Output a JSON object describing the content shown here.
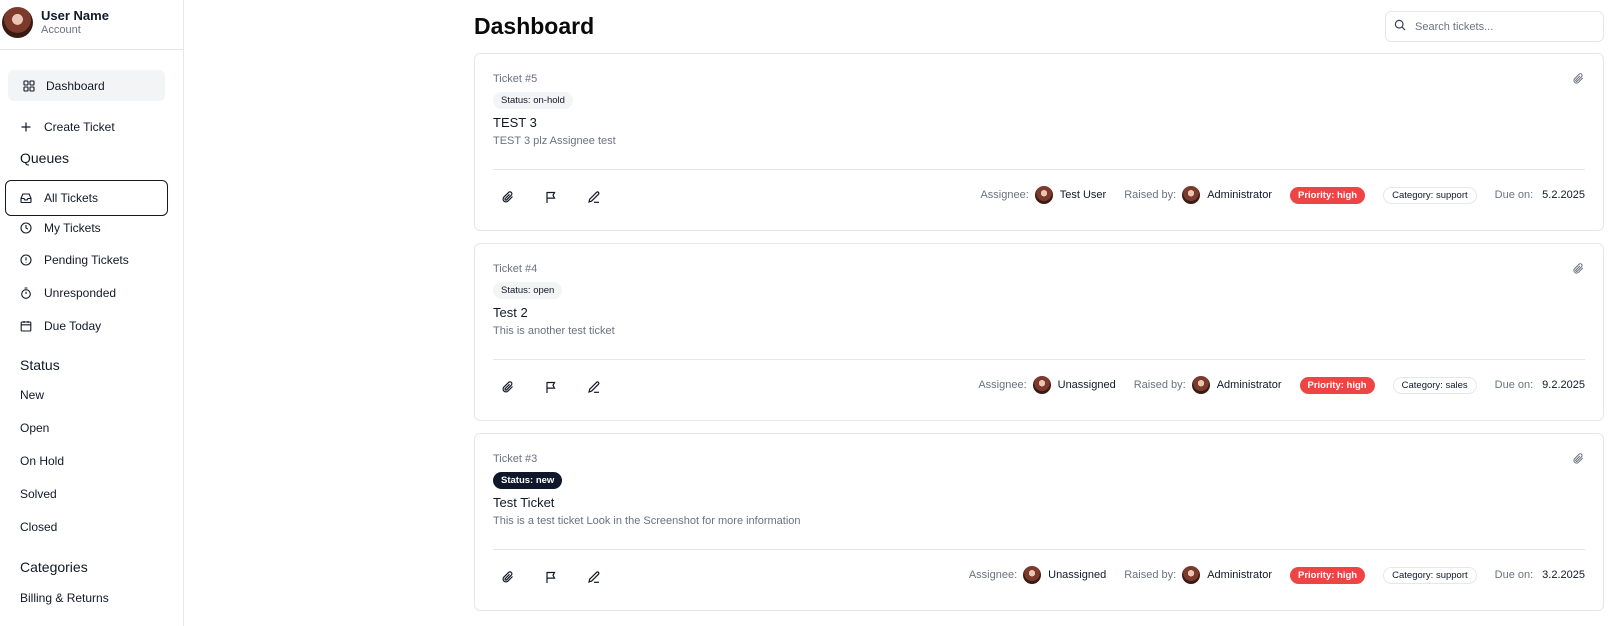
{
  "user": {
    "name": "User Name",
    "sub": "Account"
  },
  "nav": {
    "dashboard": "Dashboard",
    "create_ticket": "Create Ticket"
  },
  "queues": {
    "heading": "Queues",
    "items": [
      "All Tickets",
      "My Tickets",
      "Pending Tickets",
      "Unresponded",
      "Due Today"
    ]
  },
  "status_section": {
    "heading": "Status",
    "items": [
      "New",
      "Open",
      "On Hold",
      "Solved",
      "Closed"
    ]
  },
  "categories_section": {
    "heading": "Categories",
    "items": [
      "Billing & Returns"
    ]
  },
  "header": {
    "title": "Dashboard",
    "search_placeholder": "Search tickets..."
  },
  "meta_labels": {
    "assignee": "Assignee:",
    "raised_by": "Raised by:",
    "due_on": "Due on:"
  },
  "tickets": [
    {
      "number": "Ticket #5",
      "status": "Status: on-hold",
      "title": "TEST 3",
      "description": "TEST 3 plz Assignee test",
      "assignee": "Test User",
      "raised_by": "Administrator",
      "priority": "Priority: high",
      "category": "Category: support",
      "due": "5.2.2025"
    },
    {
      "number": "Ticket #4",
      "status": "Status: open",
      "title": "Test 2",
      "description": "This is another test ticket",
      "assignee": "Unassigned",
      "raised_by": "Administrator",
      "priority": "Priority: high",
      "category": "Category: sales",
      "due": "9.2.2025"
    },
    {
      "number": "Ticket #3",
      "status": "Status: new",
      "title": "Test Ticket",
      "description": "This is a test ticket Look in the Screenshot for more information",
      "assignee": "Unassigned",
      "raised_by": "Administrator",
      "priority": "Priority: high",
      "category": "Category: support",
      "due": "3.2.2025"
    }
  ],
  "colors": {
    "priority_high": "#ef4444",
    "status_new": "#0f172a",
    "muted_text": "#6b7280",
    "border": "#e5e7eb"
  }
}
